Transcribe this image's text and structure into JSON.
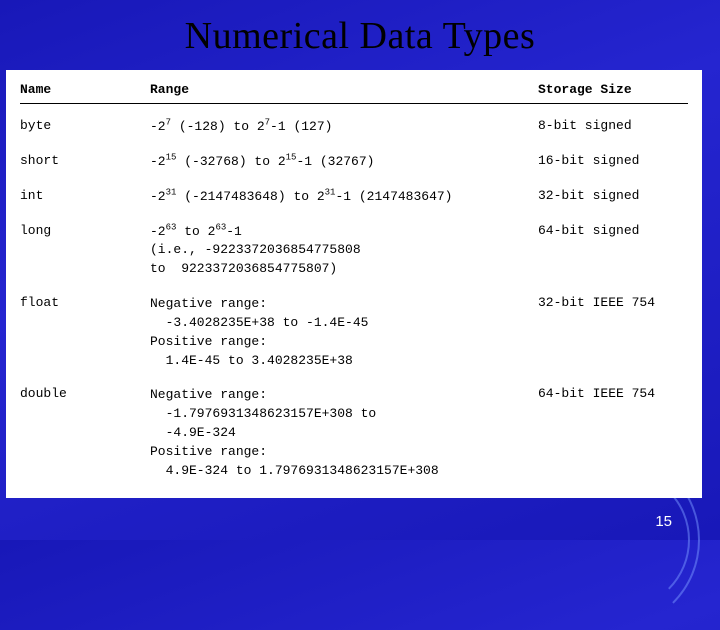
{
  "title": "Numerical Data Types",
  "headers": {
    "name": "Name",
    "range": "Range",
    "size": "Storage Size"
  },
  "rows": [
    {
      "name": "byte",
      "range_html": "-2<sup>7</sup> (-128) to 2<sup>7</sup>-1 (127)",
      "size": "8-bit signed"
    },
    {
      "name": "short",
      "range_html": "-2<sup>15</sup> (-32768) to 2<sup>15</sup>-1 (32767)",
      "size": "16-bit signed"
    },
    {
      "name": "int",
      "range_html": "-2<sup>31</sup> (-2147483648) to 2<sup>31</sup>-1 (2147483647)",
      "size": "32-bit signed"
    },
    {
      "name": "long",
      "range_html": "-2<sup>63</sup> to 2<sup>63</sup>-1<br>(i.e., -9223372036854775808<br>to&nbsp;&nbsp;9223372036854775807)",
      "size": "64-bit signed"
    },
    {
      "name": "float",
      "range_html": "Negative range:<br>&nbsp;&nbsp;-3.4028235E+38 to -1.4E-45<br>Positive range:<br>&nbsp;&nbsp;1.4E-45 to 3.4028235E+38",
      "size": "32-bit IEEE 754"
    },
    {
      "name": "double",
      "range_html": "Negative range:<br>&nbsp;&nbsp;-1.7976931348623157E+308 to<br>&nbsp;&nbsp;-4.9E-324<br>Positive range:<br>&nbsp;&nbsp;4.9E-324 to 1.7976931348623157E+308",
      "size": "64-bit IEEE 754"
    }
  ],
  "page_number": "15"
}
